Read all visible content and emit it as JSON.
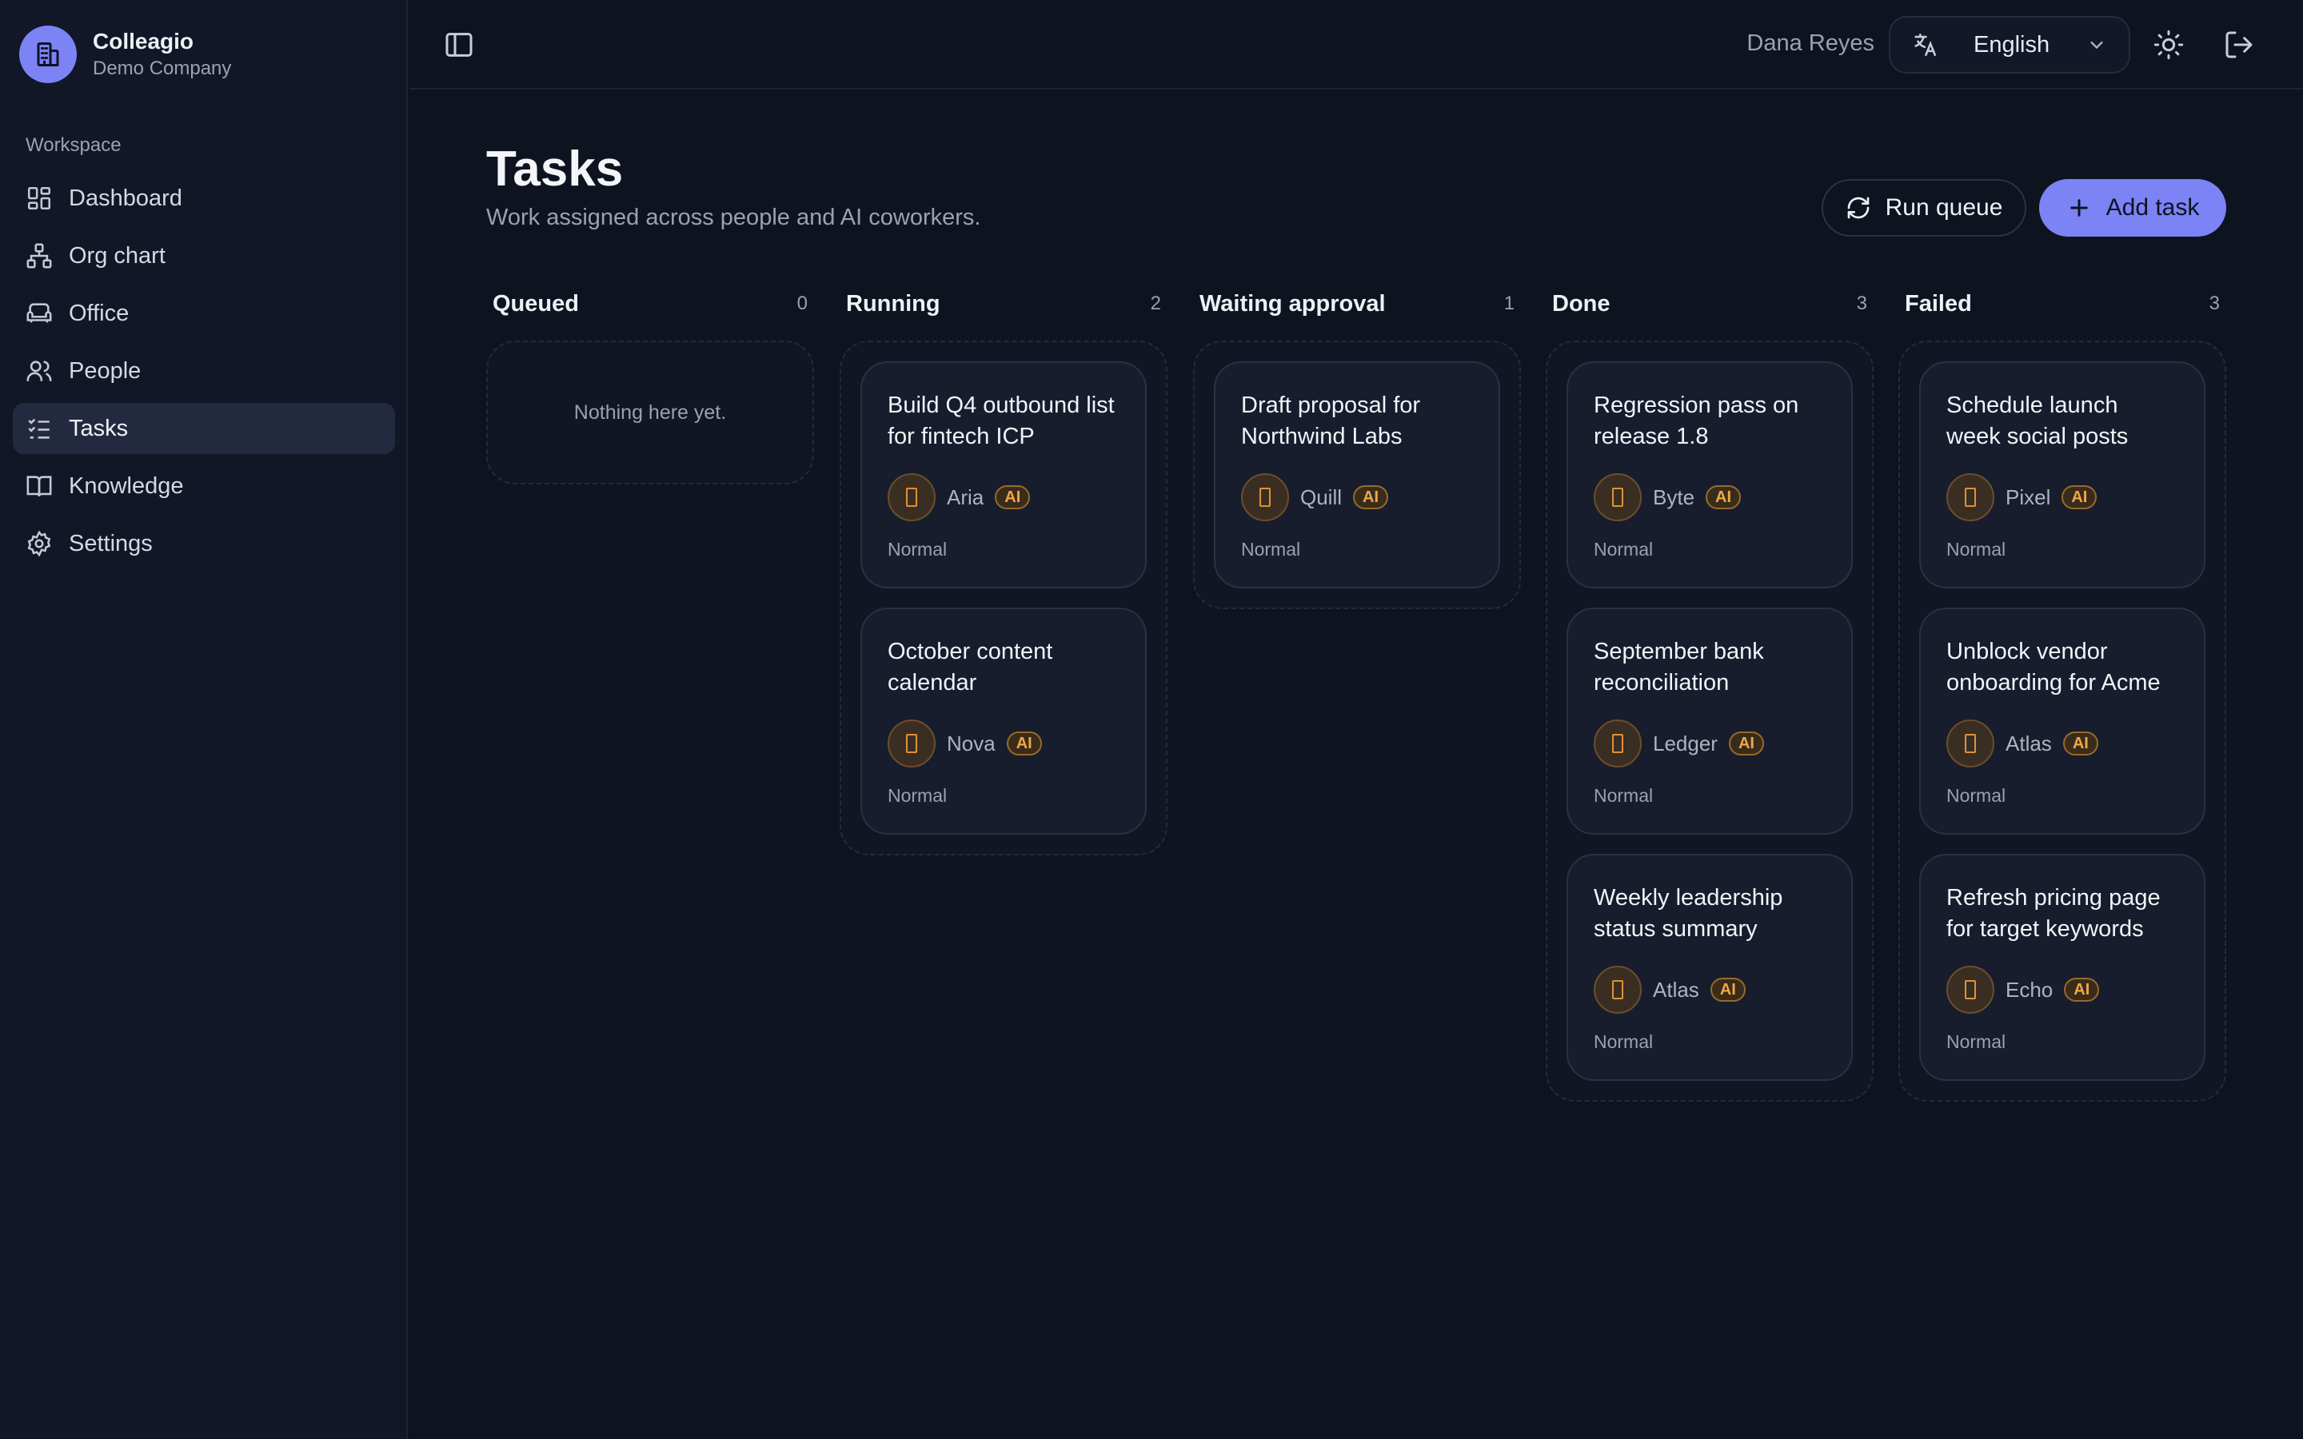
{
  "brand": {
    "name": "Colleagio",
    "subtitle": "Demo Company"
  },
  "sidebar": {
    "section_label": "Workspace",
    "items": [
      {
        "label": "Dashboard",
        "icon": "dashboard-icon"
      },
      {
        "label": "Org chart",
        "icon": "org-chart-icon"
      },
      {
        "label": "Office",
        "icon": "sofa-icon"
      },
      {
        "label": "People",
        "icon": "users-icon"
      },
      {
        "label": "Tasks",
        "icon": "checklist-icon",
        "active": true
      },
      {
        "label": "Knowledge",
        "icon": "book-icon"
      },
      {
        "label": "Settings",
        "icon": "gear-icon"
      }
    ]
  },
  "header": {
    "user_name": "Dana Reyes",
    "language": {
      "selected": "English"
    }
  },
  "page": {
    "title": "Tasks",
    "subtitle": "Work assigned across people and AI coworkers.",
    "run_queue_label": "Run queue",
    "add_task_label": "Add task"
  },
  "board": {
    "ai_badge": "AI",
    "columns": [
      {
        "title": "Queued",
        "count": "0",
        "empty_text": "Nothing here yet.",
        "cards": []
      },
      {
        "title": "Running",
        "count": "2",
        "cards": [
          {
            "title": "Build Q4 outbound list for fintech ICP",
            "assignee": "Aria",
            "priority": "Normal"
          },
          {
            "title": "October content calendar",
            "assignee": "Nova",
            "priority": "Normal"
          }
        ]
      },
      {
        "title": "Waiting approval",
        "count": "1",
        "cards": [
          {
            "title": "Draft proposal for Northwind Labs",
            "assignee": "Quill",
            "priority": "Normal"
          }
        ]
      },
      {
        "title": "Done",
        "count": "3",
        "cards": [
          {
            "title": "Regression pass on release 1.8",
            "assignee": "Byte",
            "priority": "Normal"
          },
          {
            "title": "September bank reconciliation",
            "assignee": "Ledger",
            "priority": "Normal"
          },
          {
            "title": "Weekly leadership status summary",
            "assignee": "Atlas",
            "priority": "Normal"
          }
        ]
      },
      {
        "title": "Failed",
        "count": "3",
        "cards": [
          {
            "title": "Schedule launch week social posts",
            "assignee": "Pixel",
            "priority": "Normal"
          },
          {
            "title": "Unblock vendor onboarding for Acme",
            "assignee": "Atlas",
            "priority": "Normal"
          },
          {
            "title": "Refresh pricing page for target keywords",
            "assignee": "Echo",
            "priority": "Normal"
          }
        ]
      }
    ]
  },
  "colors": {
    "accent": "#7b83f5",
    "ai_badge": "#f0a745",
    "background": "#0e1320"
  }
}
